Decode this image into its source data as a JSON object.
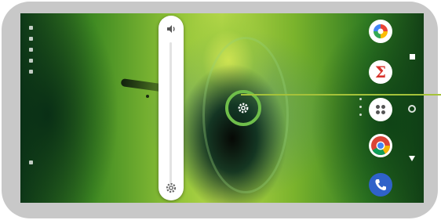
{
  "screen": {
    "wallpaper": "water-drop-green",
    "accent_colors": {
      "highlight_ring": "#6fbe4a",
      "callout_line": "#a5c23a",
      "phone_frame": "#c8c8c8",
      "volume_panel": "#ffffff"
    }
  },
  "volume_panel": {
    "top_icon": "speaker-icon",
    "bottom_icon": "settings-gear-icon",
    "level": 0
  },
  "highlight": {
    "icon": "settings-gear-icon"
  },
  "dock": {
    "apps": [
      {
        "icon": "google-photos-icon"
      },
      {
        "icon": "calculator-icon",
        "symbol": "Σ"
      },
      {
        "icon": "app-drawer-icon"
      },
      {
        "icon": "chrome-icon"
      },
      {
        "icon": "phone-icon"
      }
    ]
  },
  "nav": {
    "recent_icon": "recent-apps-icon",
    "home_icon": "home-icon",
    "back_icon": "back-icon"
  }
}
